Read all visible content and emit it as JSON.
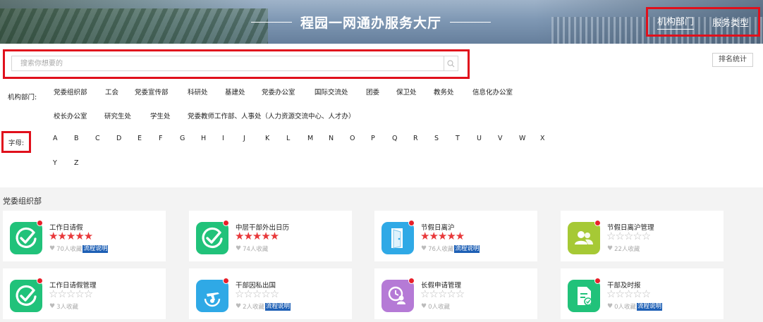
{
  "header": {
    "title": "程园一网通办服务大厅",
    "nav": [
      {
        "label": "机构部门",
        "active": true
      },
      {
        "label": "服务类型",
        "active": false
      }
    ]
  },
  "search": {
    "placeholder": "搜索你想要的",
    "rank_label": "排名统计"
  },
  "filters": {
    "dept_label": "机构部门:",
    "dept_row1": [
      "党委组织部",
      "工会",
      "党委宣传部",
      "科研处",
      "基建处",
      "党委办公室",
      "国际交流处",
      "团委",
      "保卫处",
      "教务处",
      "信息化办公室"
    ],
    "dept_row2": [
      "校长办公室",
      "研究生处",
      "学生处",
      "党委教师工作部、人事处（人力资源交流中心、人才办）"
    ],
    "letter_label": "字母:",
    "letters_row1": [
      "A",
      "B",
      "C",
      "D",
      "E",
      "F",
      "G",
      "H",
      "I",
      "J",
      "K",
      "L",
      "M",
      "N",
      "O",
      "P",
      "Q",
      "R",
      "S",
      "T",
      "U",
      "V",
      "W",
      "X"
    ],
    "letters_row2": [
      "Y",
      "Z"
    ]
  },
  "section": {
    "title": "党委组织部"
  },
  "colors": {
    "highlight_border": "#e0101c",
    "star_red": "#e8383a",
    "guide_blue": "#1d5fb5"
  },
  "cards": [
    {
      "name": "工作日请假",
      "rating": 5,
      "favorites": "70人收藏",
      "guide": "流程说明",
      "icon": "check-circle-icon",
      "icon_bg": "#21c27a"
    },
    {
      "name": "中层干部外出日历",
      "rating": 5,
      "favorites": "74人收藏",
      "guide": "",
      "icon": "check-circle-icon",
      "icon_bg": "#21c27a"
    },
    {
      "name": "节假日离沪",
      "rating": 5,
      "favorites": "76人收藏",
      "guide": "流程说明",
      "icon": "door-exit-icon",
      "icon_bg": "#2fa9e6"
    },
    {
      "name": "节假日离沪管理",
      "rating": 0,
      "favorites": "22人收藏",
      "guide": "",
      "icon": "users-icon",
      "icon_bg": "#a6c935"
    },
    {
      "name": "工作日请假管理",
      "rating": 0,
      "favorites": "3人收藏",
      "guide": "",
      "icon": "check-circle-icon",
      "icon_bg": "#21c27a"
    },
    {
      "name": "干部因私出国",
      "rating": 0,
      "favorites": "2人收藏",
      "guide": "流程说明",
      "icon": "airplane-globe-icon",
      "icon_bg": "#2fa9e6"
    },
    {
      "name": "长假申请管理",
      "rating": 0,
      "favorites": "0人收藏",
      "guide": "",
      "icon": "clock-user-icon",
      "icon_bg": "#b57ad6"
    },
    {
      "name": "干部及时报",
      "rating": 0,
      "favorites": "0人收藏",
      "guide": "流程说明",
      "icon": "document-report-icon",
      "icon_bg": "#21c27a"
    }
  ]
}
